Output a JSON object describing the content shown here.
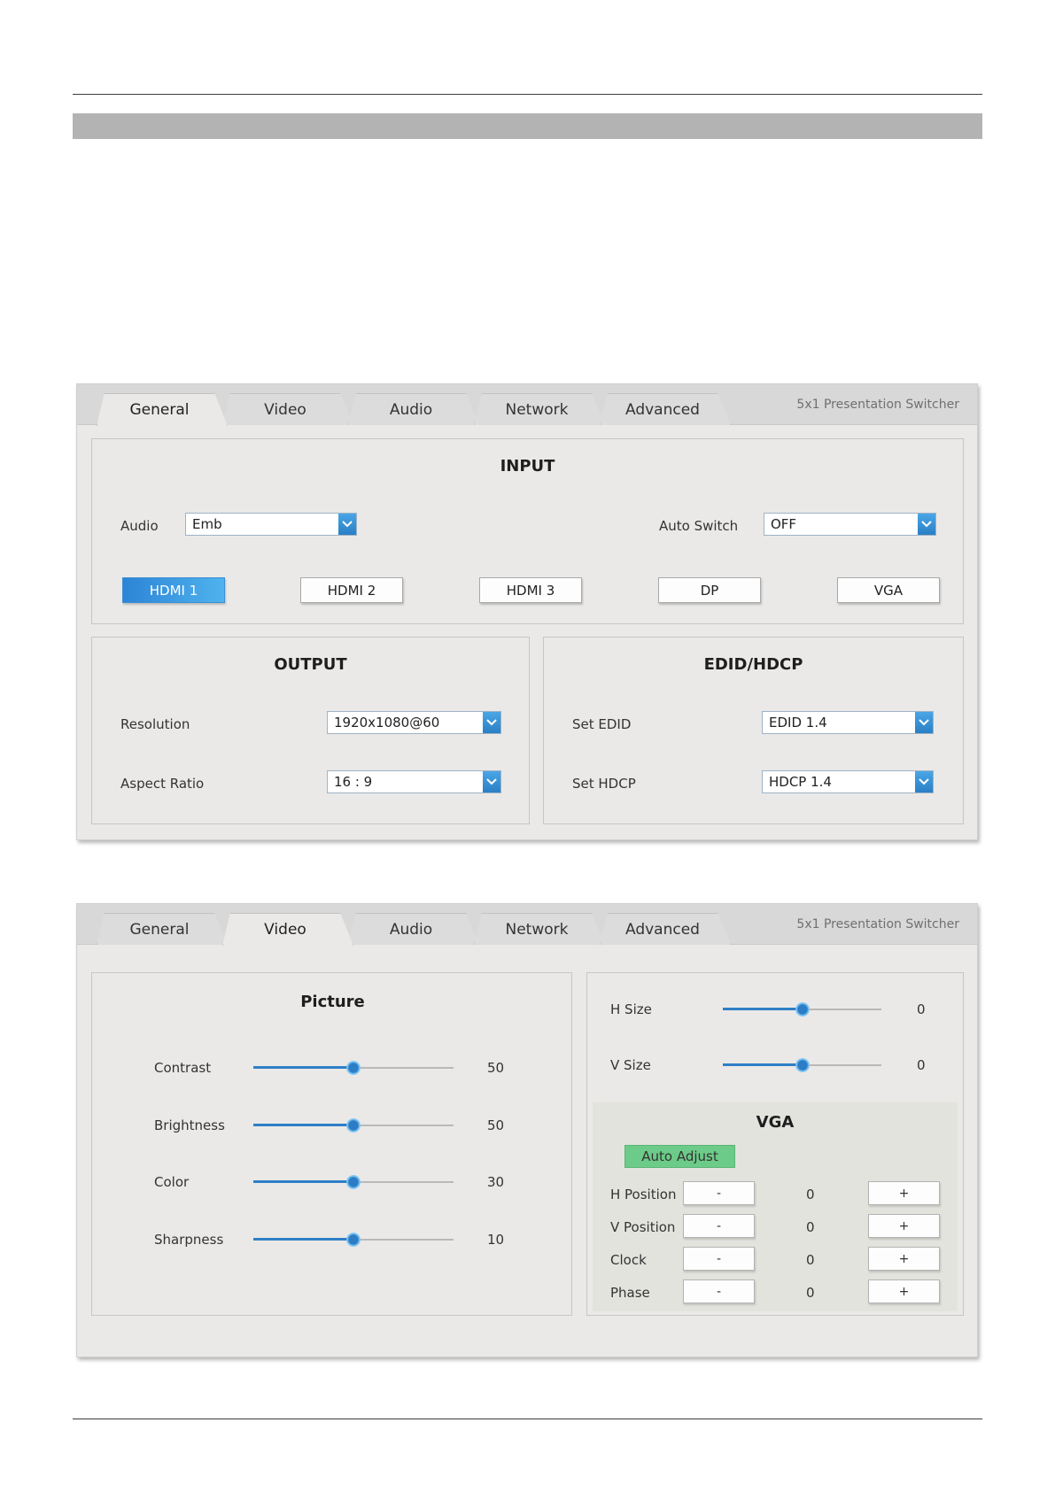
{
  "panels": [
    {
      "tabs": [
        "General",
        "Video",
        "Audio",
        "Network",
        "Advanced"
      ],
      "active_tab": 0,
      "product": "5x1 Presentation Switcher",
      "input": {
        "title": "INPUT",
        "audio_label": "Audio",
        "audio_value": "Emb",
        "auto_switch_label": "Auto Switch",
        "auto_switch_value": "OFF",
        "sources": [
          "HDMI 1",
          "HDMI 2",
          "HDMI 3",
          "DP",
          "VGA"
        ],
        "active_source": 0
      },
      "output": {
        "title": "OUTPUT",
        "resolution_label": "Resolution",
        "resolution_value": "1920x1080@60",
        "aspect_label": "Aspect Ratio",
        "aspect_value": "16 : 9"
      },
      "edid": {
        "title": "EDID/HDCP",
        "edid_label": "Set EDID",
        "edid_value": "EDID 1.4",
        "hdcp_label": "Set HDCP",
        "hdcp_value": "HDCP 1.4"
      }
    },
    {
      "tabs": [
        "General",
        "Video",
        "Audio",
        "Network",
        "Advanced"
      ],
      "active_tab": 1,
      "product": "5x1 Presentation Switcher",
      "picture": {
        "title": "Picture",
        "sliders": [
          {
            "label": "Contrast",
            "value": "50",
            "level": 0.5
          },
          {
            "label": "Brightness",
            "value": "50",
            "level": 0.5
          },
          {
            "label": "Color",
            "value": "30",
            "level": 0.5
          },
          {
            "label": "Sharpness",
            "value": "10",
            "level": 0.5
          }
        ]
      },
      "size": {
        "sliders": [
          {
            "label": "H Size",
            "value": "0",
            "level": 0.5
          },
          {
            "label": "V Size",
            "value": "0",
            "level": 0.5
          }
        ]
      },
      "vga": {
        "title": "VGA",
        "auto_adjust": "Auto Adjust",
        "rows": [
          {
            "label": "H Position",
            "minus": "-",
            "value": "0",
            "plus": "+"
          },
          {
            "label": "V Position",
            "minus": "-",
            "value": "0",
            "plus": "+"
          },
          {
            "label": "Clock",
            "minus": "-",
            "value": "0",
            "plus": "+"
          },
          {
            "label": "Phase",
            "minus": "-",
            "value": "0",
            "plus": "+"
          }
        ]
      }
    }
  ],
  "colors": {
    "accent_blue": "#2f7fc6",
    "active_source_gradient": [
      "#2d84d6",
      "#4fb3ee"
    ],
    "auto_adjust_green": "#6ccb88",
    "panel_bg": "#eae9e7",
    "section_bar": "#b3b3b3"
  }
}
